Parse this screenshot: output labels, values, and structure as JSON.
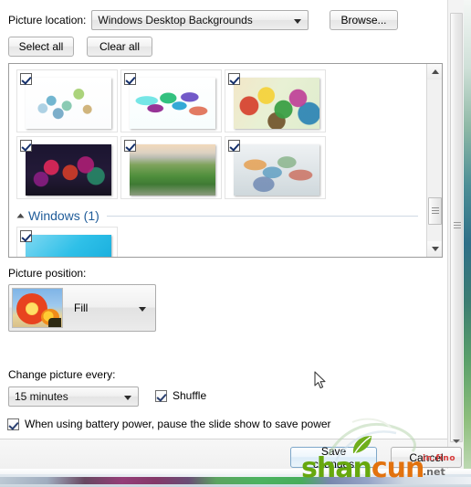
{
  "picture_location": {
    "label": "Picture location:",
    "selected": "Windows Desktop Backgrounds",
    "browse_label": "Browse..."
  },
  "selection_buttons": {
    "select_all": "Select all",
    "clear_all": "Clear all"
  },
  "gallery": {
    "thumbnails": [
      {
        "name": "thumb-1",
        "checked": true,
        "desc": "light blue-green splatter on white"
      },
      {
        "name": "thumb-2",
        "checked": true,
        "desc": "colorful crystal shapes on white"
      },
      {
        "name": "thumb-3",
        "checked": true,
        "desc": "bright multicolor abstract"
      },
      {
        "name": "thumb-4",
        "checked": true,
        "desc": "dark magenta and red abstract"
      },
      {
        "name": "thumb-5",
        "checked": true,
        "desc": "green field with warm sky"
      },
      {
        "name": "thumb-6",
        "checked": true,
        "desc": "pastel abstract collage"
      }
    ],
    "group": {
      "title": "Windows (1)",
      "expanded": true,
      "thumbnails": [
        {
          "name": "thumb-windows-1",
          "checked": true,
          "desc": "cyan blue gradient"
        }
      ]
    }
  },
  "picture_position": {
    "label": "Picture position:",
    "selected": "Fill"
  },
  "change_picture": {
    "label": "Change picture every:",
    "selected": "15 minutes"
  },
  "shuffle": {
    "label": "Shuffle",
    "checked": true
  },
  "battery": {
    "label": "When using battery power, pause the slide show to save power",
    "checked": true
  },
  "footer": {
    "save_label": "Save changes",
    "cancel_label": "Cancel"
  },
  "watermark": {
    "part1": "shan",
    "part2": "cun",
    "info": "in.fino",
    "net": ".net"
  },
  "colors": {
    "accent_link": "#1f5c99",
    "save_border": "#7ea7c9",
    "watermark_green": "#67a80e",
    "watermark_orange": "#e2720e"
  }
}
